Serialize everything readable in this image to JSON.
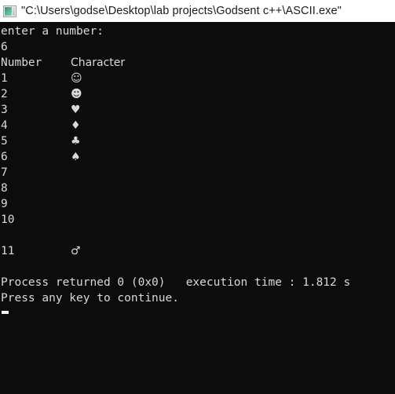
{
  "window": {
    "title": "\"C:\\Users\\godse\\Desktop\\lab projects\\Godsent c++\\ASCII.exe\"",
    "icon": "console-app-icon",
    "background_color": "#0c0c0c",
    "titlebar_color": "#ffffff",
    "text_color": "#d6d9de"
  },
  "terminal": {
    "prompt_line": "enter a number:",
    "input_value": "6",
    "headers": {
      "number": "Number",
      "character": "Character"
    },
    "rows": [
      {
        "number": "1",
        "character": "☺"
      },
      {
        "number": "2",
        "character": "☻"
      },
      {
        "number": "3",
        "character": "♥"
      },
      {
        "number": "4",
        "character": "♦"
      },
      {
        "number": "5",
        "character": "♣"
      },
      {
        "number": "6",
        "character": "♠"
      },
      {
        "number": "7",
        "character": ""
      },
      {
        "number": "8",
        "character": ""
      },
      {
        "number": "9",
        "character": ""
      },
      {
        "number": "10",
        "character": ""
      },
      {
        "number": "",
        "character": ""
      },
      {
        "number": "11",
        "character": "♂"
      }
    ],
    "exit_line": "Process returned 0 (0x0)   execution time : 1.812 s",
    "continue_line": "Press any key to continue.",
    "cursor": "block-cursor"
  }
}
